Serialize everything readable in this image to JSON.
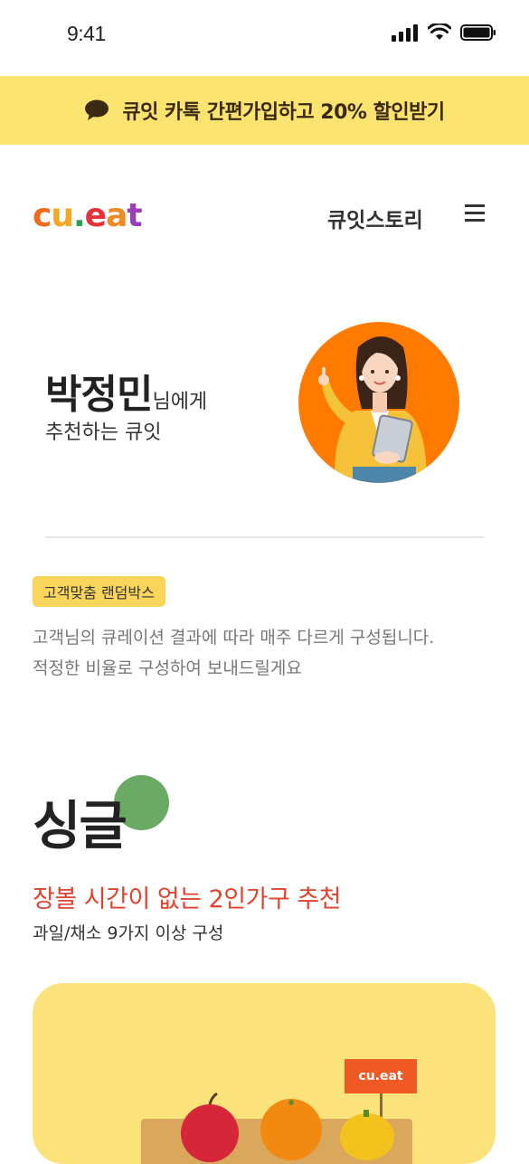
{
  "status_bar": {
    "time": "9:41"
  },
  "banner": {
    "icon": "chat-bubble-icon",
    "text": "큐잇 카톡 간편가입하고 20% 할인받기"
  },
  "header": {
    "logo": {
      "c": "c",
      "u": "u",
      "dot": ".",
      "e": "e",
      "a": "a",
      "t": "t"
    },
    "nav_story": "큐잇스토리",
    "menu_icon": "hamburger-menu-icon"
  },
  "greeting": {
    "name": "박정민",
    "suffix": "님에게",
    "line2": "추천하는 큐잇"
  },
  "random_box": {
    "tag": "고객맞춤 랜덤박스",
    "desc_line1": "고객님의 큐레이션 결과에 따라 매주 다르게 구성됩니다.",
    "desc_line2": "적정한 비율로 구성하여 보내드릴게요"
  },
  "plan": {
    "title": "싱글",
    "subtitle": "장볼 시간이 없는 2인가구 추천",
    "note": "과일/채소 9가지 이상 구성",
    "flag_label": "cu.eat"
  },
  "colors": {
    "banner_bg": "#fbe36f",
    "accent_red": "#e0442e",
    "avatar_bg": "#ff7a00",
    "tag_bg": "#f9d65b",
    "dot_green": "#6aaa64",
    "card_bg": "#fbe27a"
  }
}
